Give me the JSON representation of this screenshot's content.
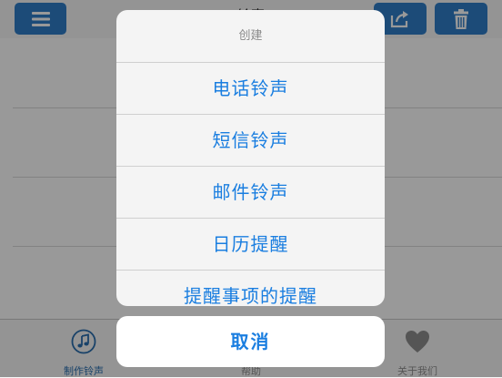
{
  "navbar": {
    "title": "铃声"
  },
  "tabbar": {
    "tabs": [
      {
        "label": "制作铃声",
        "icon": "music-note-icon",
        "active": true
      },
      {
        "label": "帮助",
        "icon": "help-icon",
        "active": false
      },
      {
        "label": "关于我们",
        "icon": "heart-icon",
        "active": false
      }
    ]
  },
  "action_sheet": {
    "title": "创建",
    "items": [
      "电话铃声",
      "短信铃声",
      "邮件铃声",
      "日历提醒",
      "提醒事项的提醒"
    ],
    "cancel_label": "取消"
  },
  "colors": {
    "accent": "#1a7ee0",
    "nav_button": "#2f7ec8",
    "tab_active": "#2a6fb0"
  }
}
